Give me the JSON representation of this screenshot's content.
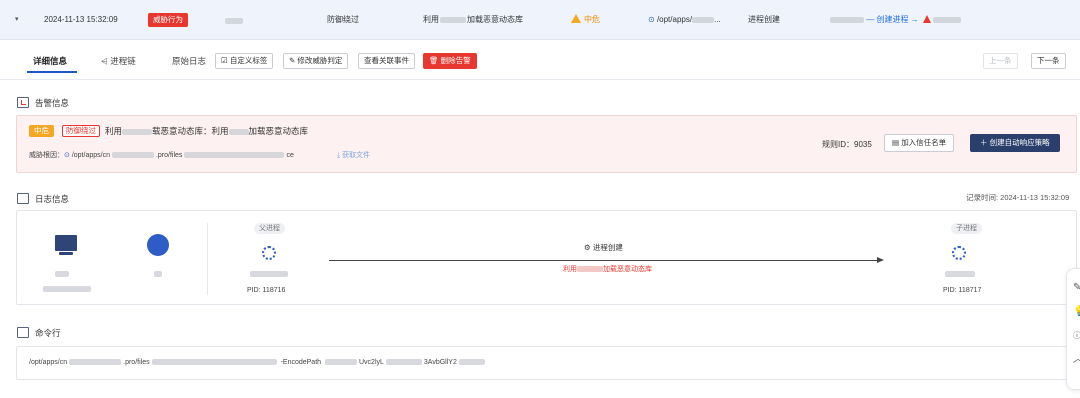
{
  "alert_row": {
    "caret": "▾",
    "time": "2024-11-13 15:32:09",
    "type_badge": "威胁行为",
    "status": "防御绕过",
    "rule_prefix": "利用",
    "rule_suffix": "加载恶意动态库",
    "level": "中危",
    "path": "/opt/apps/",
    "path_ellipsis": "...",
    "action": "进程创建",
    "chain_label": "— 创建进程 →"
  },
  "tabs": {
    "detail": "详细信息",
    "process_chain": "进程链",
    "raw_log": "原始日志"
  },
  "toolbar": {
    "custom_tag": "自定义标签",
    "modify_judge": "修改威胁判定",
    "view_events": "查看关联事件",
    "delete_alert": "删除告警",
    "prev": "上一条",
    "next": "下一条"
  },
  "alert_info": {
    "section_title": "告警信息",
    "level_badge": "中危",
    "bypass_badge": "防御绕过",
    "desc_a": "利用",
    "desc_b": "载恶意动态库：利用",
    "desc_c": "加载恶意动态库",
    "root_label": "威胁根因：",
    "root_path_a": "/opt/apps/cn",
    "root_path_b": ".pro/files",
    "root_path_end": "ce",
    "fetch_file": "获取文件",
    "rule_id": "规则ID：9035",
    "add_trust": "加入信任名单",
    "create_policy": "创建自动响应策略"
  },
  "log_info": {
    "section_title": "日志信息",
    "record_time": "记录时间: 2024-11-13 15:32:09",
    "parent_label": "父进程",
    "parent_pid": "PID: 118716",
    "action": "进程创建",
    "action_desc_a": "利用",
    "action_desc_b": "加载恶意动态库",
    "child_label": "子进程",
    "child_pid": "PID: 118717"
  },
  "cmdline": {
    "section_title": "命令行",
    "path_a": "/opt/apps/cn",
    "path_b": ".pro/files",
    "encode": "-EncodePath",
    "frag_a": "Uvc2lyL",
    "frag_b": "3AvbGllY2"
  },
  "colors": {
    "danger": "#e8372e",
    "warning": "#f5a623",
    "primary": "#2a3f6c",
    "link": "#1e6fd9"
  }
}
